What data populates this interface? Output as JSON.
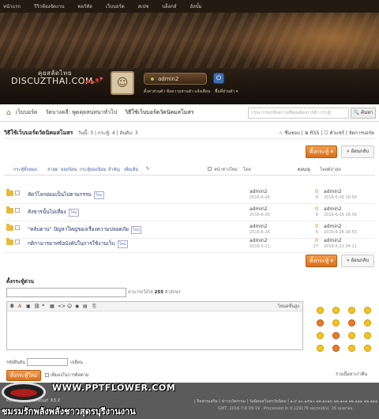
{
  "topnav": [
    "หน้าแรก",
    "รีวิวห้องจัดงาน",
    "พอร์ทัล",
    "เว็บบอร์ด",
    "สเปซ",
    "บล็อกส์",
    "อัลบั้ม"
  ],
  "logo": {
    "thai": "คุยสลัดไทย",
    "name": "DISCUZTHAI.COM"
  },
  "user": {
    "name": "admin2",
    "links": "ตั้งค่าส่วนตัว  ข้อความส่วนตัว  แจ้งเตือน",
    "extra": "พื้นที่ส่วนตัว ▾"
  },
  "menubar": {
    "items": [
      "เว็บบอร์ด",
      "วัดบางคลี่: พูดคุยสนทนาทั่วไป",
      "วิธีใช้เว็บบอร์ดวัดนิคมสโมสร"
    ]
  },
  "search": {
    "placeholder": "กรุณากรอกข้อความที่คุณต้องการค้า กระทู้",
    "button": "ค้นหา"
  },
  "forum": {
    "title": "วิธีใช้เว็บบอร์ดวัดนิคมสโมสร",
    "stats": "วันนี้: 3 | กระทู้: 4 | อันดับ: 3",
    "rightlinks": "☆ ชื่นชอบ | ⊕ RSS | ☐ ตัวแชร์ | จัดการบอร์ด"
  },
  "buttons": {
    "new": "ตั้งกระทู้ ▾",
    "back": "« ย้อนกลับ",
    "submit": "ตั้งกระทู้ใหม่"
  },
  "filters": {
    "links": [
      "กระทู้ทั้งหมด",
      "ล่าสุด",
      "ยอดนิยม",
      "กระทู้ยอดนิยม",
      "สำคัญ",
      "เพิ่มเติม"
    ],
    "newwindow": "หน้าต่างใหม่",
    "by": "โดย",
    "replies": "ตอบ/ดู",
    "lastpost": "โพสต์ล่าสุด"
  },
  "threads": [
    {
      "title": "สัตว์โลกย่อมเป็นไปตามกรรม",
      "author": "admin2",
      "date": "2016-6-26",
      "replies": "0",
      "views": "8",
      "last": "admin2",
      "last_date": "2016-6-26 16:56"
    },
    {
      "title": "สังขารนั้นไม่เที่ยง",
      "author": "admin2",
      "date": "2016-6-26",
      "replies": "0",
      "views": "8",
      "last": "admin2",
      "last_date": "2016-6-26 16:56"
    },
    {
      "title": "\"หลับตาน\"  ปัญหาใหญ่ของเรื่องความปลอดภัย",
      "author": "admin2",
      "date": "2016-6-26",
      "replies": "0",
      "views": "6",
      "last": "admin2",
      "last_date": "2016-6-26 16:55"
    },
    {
      "title": "กติกามารยาทข้อบังคับในการใช้งานเว็บ",
      "author": "admin2",
      "date": "2016-5-21",
      "replies": "0",
      "views": "27",
      "last": "admin2",
      "last_date": "2016-5-21 04:12"
    }
  ],
  "quickpost": {
    "title": "ตั้งกระทู้ด่วน",
    "limit_text": "สามารถใส่ได้",
    "limit_num": "255",
    "limit_unit": "ตัวอักษร",
    "advanced": "โหมดขั้นสูง",
    "verify_label": "รหัสยืนยัน",
    "verify_hint": "เปลี่ยน",
    "checkbox": "เพิ่มลงในการติดตาม",
    "restore": "ร่างเนื้อหาเก่าคืน"
  },
  "footer": {
    "powered": "Powered by Discuz! X3.2",
    "links": "| ปิดส่วนเสริม | ข่าวนวัตกรรม | วัดนิคมสโมสรวัดนิคม | ๑.๔ ๑๐.๑๕๑๐ ๑๒.๑๐๑๖ ๑๒.๑๐๑ ๑๒.๑๑๑ ๑๒.๑๑๑",
    "stats": "GMT, 2016-7-8 09:19 , Processed in 0.129176 second(s), 26 queries ."
  },
  "watermark": {
    "url": "WWW.PPTFLOWER.COM",
    "thai": "ชมรมรักพลังพลังชาวสุดรบุรีงานงาน"
  },
  "colors": {
    "accent": "#e8812e",
    "header_dark": "#231a12",
    "footer": "#5b5b5b"
  }
}
